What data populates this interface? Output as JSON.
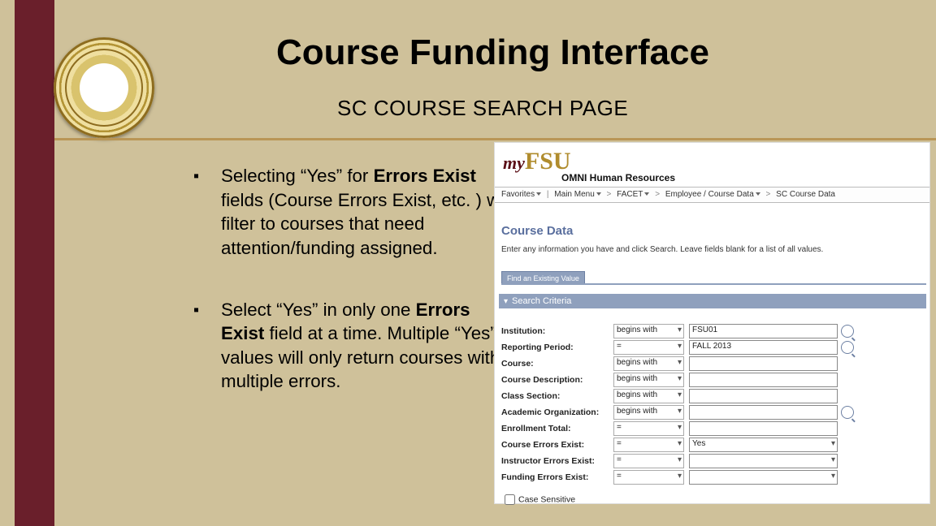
{
  "title": "Course Funding Interface",
  "subtitle": "SC COURSE SEARCH PAGE",
  "bullets": [
    {
      "pre": "Selecting “Yes” for ",
      "bold": "Errors Exist",
      "post": " fields (Course Errors Exist, etc. ) will filter to courses that need attention/funding assigned."
    },
    {
      "pre": "Select “Yes” in only one ",
      "bold": "Errors Exist",
      "post": " field at a time. Multiple “Yes” values will only return courses with multiple errors."
    }
  ],
  "logo": {
    "my": "my",
    "fsu": "FSU"
  },
  "omni": "OMNI Human Resources",
  "breadcrumb": [
    "Favorites",
    "Main Menu",
    "FACET",
    "Employee / Course Data",
    "SC Course Data"
  ],
  "section": "Course Data",
  "hint": "Enter any information you have and click Search. Leave fields blank for a list of all values.",
  "tab": "Find an Existing Value",
  "sc_header": "Search Criteria",
  "rows": [
    {
      "label": "Institution:",
      "op": "begins with",
      "val": "FSU01",
      "lookup": true
    },
    {
      "label": "Reporting Period:",
      "op": "=",
      "val": "FALL 2013",
      "lookup": true
    },
    {
      "label": "Course:",
      "op": "begins with",
      "val": ""
    },
    {
      "label": "Course Description:",
      "op": "begins with",
      "val": ""
    },
    {
      "label": "Class Section:",
      "op": "begins with",
      "val": ""
    },
    {
      "label": "Academic Organization:",
      "op": "begins with",
      "val": "",
      "lookup": true
    },
    {
      "label": "Enrollment Total:",
      "op": "=",
      "val": ""
    },
    {
      "label": "Course Errors Exist:",
      "op": "=",
      "val": "Yes",
      "dd": true
    },
    {
      "label": "Instructor Errors Exist:",
      "op": "=",
      "val": "",
      "dd": true
    },
    {
      "label": "Funding Errors Exist:",
      "op": "=",
      "val": "",
      "dd": true
    }
  ],
  "case_sensitive": "Case Sensitive"
}
